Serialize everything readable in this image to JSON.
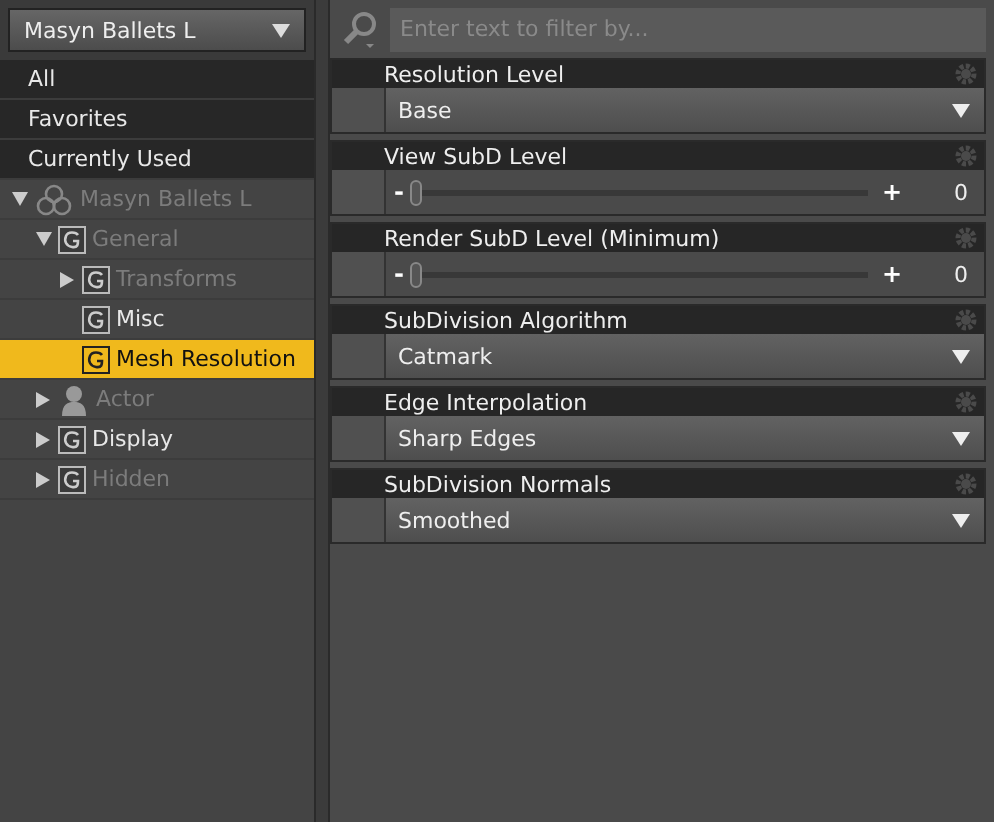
{
  "node_selector": {
    "value": "Masyn Ballets L"
  },
  "filters": [
    {
      "label": "All",
      "selected": false
    },
    {
      "label": "Favorites",
      "selected": false
    },
    {
      "label": "Currently Used",
      "selected": false
    }
  ],
  "tree": [
    {
      "label": "Masyn Ballets L",
      "kind": "figure",
      "expanded": true,
      "disabled": true,
      "selected": false,
      "children": [
        {
          "label": "General",
          "kind": "group",
          "expanded": true,
          "disabled": true,
          "selected": false,
          "children": [
            {
              "label": "Transforms",
              "kind": "group",
              "expanded": false,
              "disabled": true,
              "selected": false
            },
            {
              "label": "Misc",
              "kind": "group",
              "disabled": false,
              "selected": false
            },
            {
              "label": "Mesh Resolution",
              "kind": "group",
              "disabled": false,
              "selected": true
            }
          ]
        },
        {
          "label": "Actor",
          "kind": "actor",
          "expanded": false,
          "disabled": true,
          "selected": false
        },
        {
          "label": "Display",
          "kind": "group",
          "expanded": false,
          "disabled": false,
          "selected": false
        },
        {
          "label": "Hidden",
          "kind": "group",
          "expanded": false,
          "disabled": true,
          "selected": false
        }
      ]
    }
  ],
  "search": {
    "placeholder": "Enter text to filter by..."
  },
  "properties": [
    {
      "label": "Resolution Level",
      "kind": "dropdown",
      "value": "Base"
    },
    {
      "label": "View SubD Level",
      "kind": "slider",
      "level": 0,
      "minus": "-",
      "plus": "+",
      "reading": "0"
    },
    {
      "label": "Render SubD Level (Minimum)",
      "kind": "slider",
      "level": 0,
      "minus": "-",
      "plus": "+",
      "reading": "0"
    },
    {
      "label": "SubDivision Algorithm",
      "kind": "dropdown",
      "value": "Catmark"
    },
    {
      "label": "Edge Interpolation",
      "kind": "dropdown",
      "value": "Sharp Edges"
    },
    {
      "label": "SubDivision Normals",
      "kind": "dropdown",
      "value": "Smoothed"
    }
  ]
}
